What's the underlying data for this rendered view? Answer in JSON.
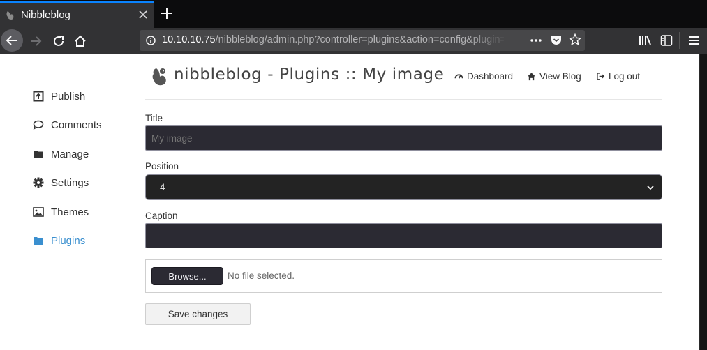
{
  "browser": {
    "tab_title": "Nibbleblog",
    "url_host": "10.10.10.75",
    "url_path": "/nibbleblog/admin.php?controller=plugins&action=config&plugin=my_image",
    "colors": {
      "tab_accent": "#0a84ff",
      "chrome_dark": "#0c0c0d",
      "toolbar": "#323234"
    }
  },
  "sidebar": {
    "items": [
      {
        "label": "Publish",
        "icon": "publish-icon"
      },
      {
        "label": "Comments",
        "icon": "comment-icon"
      },
      {
        "label": "Manage",
        "icon": "folder-icon"
      },
      {
        "label": "Settings",
        "icon": "gear-icon"
      },
      {
        "label": "Themes",
        "icon": "image-icon"
      },
      {
        "label": "Plugins",
        "icon": "folder-icon",
        "active": true
      }
    ],
    "active_color": "#3a8fcf"
  },
  "header": {
    "title": "nibbleblog - Plugins :: My image",
    "links": [
      {
        "label": "Dashboard",
        "icon": "dashboard-icon"
      },
      {
        "label": "View Blog",
        "icon": "home-icon"
      },
      {
        "label": "Log out",
        "icon": "logout-icon"
      }
    ]
  },
  "form": {
    "title_label": "Title",
    "title_placeholder": "My image",
    "title_value": "",
    "position_label": "Position",
    "position_value": "4",
    "caption_label": "Caption",
    "caption_value": "",
    "browse_label": "Browse...",
    "file_status": "No file selected.",
    "save_label": "Save changes"
  }
}
